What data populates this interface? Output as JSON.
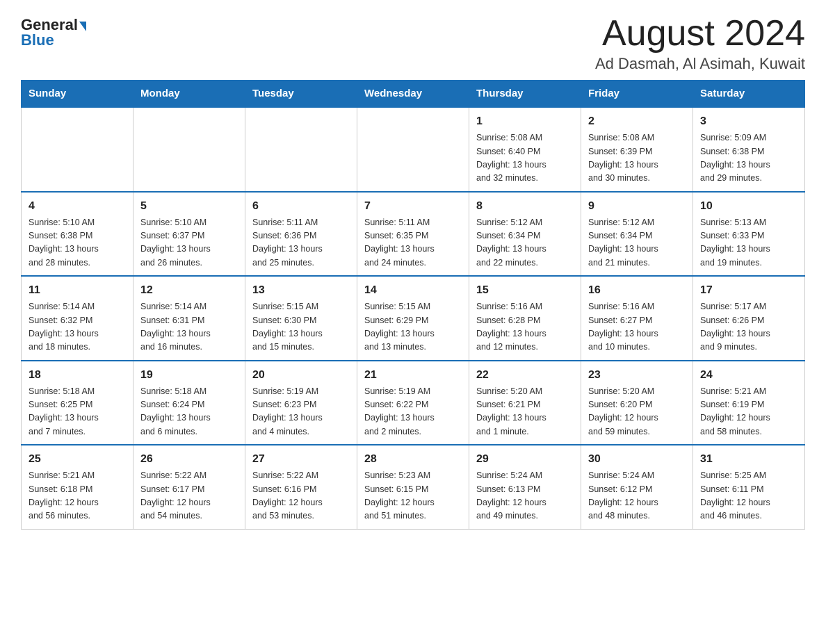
{
  "header": {
    "logo_general": "General",
    "logo_blue": "Blue",
    "month_title": "August 2024",
    "location": "Ad Dasmah, Al Asimah, Kuwait"
  },
  "weekdays": [
    "Sunday",
    "Monday",
    "Tuesday",
    "Wednesday",
    "Thursday",
    "Friday",
    "Saturday"
  ],
  "weeks": [
    {
      "days": [
        {
          "num": "",
          "info": ""
        },
        {
          "num": "",
          "info": ""
        },
        {
          "num": "",
          "info": ""
        },
        {
          "num": "",
          "info": ""
        },
        {
          "num": "1",
          "info": "Sunrise: 5:08 AM\nSunset: 6:40 PM\nDaylight: 13 hours\nand 32 minutes."
        },
        {
          "num": "2",
          "info": "Sunrise: 5:08 AM\nSunset: 6:39 PM\nDaylight: 13 hours\nand 30 minutes."
        },
        {
          "num": "3",
          "info": "Sunrise: 5:09 AM\nSunset: 6:38 PM\nDaylight: 13 hours\nand 29 minutes."
        }
      ]
    },
    {
      "days": [
        {
          "num": "4",
          "info": "Sunrise: 5:10 AM\nSunset: 6:38 PM\nDaylight: 13 hours\nand 28 minutes."
        },
        {
          "num": "5",
          "info": "Sunrise: 5:10 AM\nSunset: 6:37 PM\nDaylight: 13 hours\nand 26 minutes."
        },
        {
          "num": "6",
          "info": "Sunrise: 5:11 AM\nSunset: 6:36 PM\nDaylight: 13 hours\nand 25 minutes."
        },
        {
          "num": "7",
          "info": "Sunrise: 5:11 AM\nSunset: 6:35 PM\nDaylight: 13 hours\nand 24 minutes."
        },
        {
          "num": "8",
          "info": "Sunrise: 5:12 AM\nSunset: 6:34 PM\nDaylight: 13 hours\nand 22 minutes."
        },
        {
          "num": "9",
          "info": "Sunrise: 5:12 AM\nSunset: 6:34 PM\nDaylight: 13 hours\nand 21 minutes."
        },
        {
          "num": "10",
          "info": "Sunrise: 5:13 AM\nSunset: 6:33 PM\nDaylight: 13 hours\nand 19 minutes."
        }
      ]
    },
    {
      "days": [
        {
          "num": "11",
          "info": "Sunrise: 5:14 AM\nSunset: 6:32 PM\nDaylight: 13 hours\nand 18 minutes."
        },
        {
          "num": "12",
          "info": "Sunrise: 5:14 AM\nSunset: 6:31 PM\nDaylight: 13 hours\nand 16 minutes."
        },
        {
          "num": "13",
          "info": "Sunrise: 5:15 AM\nSunset: 6:30 PM\nDaylight: 13 hours\nand 15 minutes."
        },
        {
          "num": "14",
          "info": "Sunrise: 5:15 AM\nSunset: 6:29 PM\nDaylight: 13 hours\nand 13 minutes."
        },
        {
          "num": "15",
          "info": "Sunrise: 5:16 AM\nSunset: 6:28 PM\nDaylight: 13 hours\nand 12 minutes."
        },
        {
          "num": "16",
          "info": "Sunrise: 5:16 AM\nSunset: 6:27 PM\nDaylight: 13 hours\nand 10 minutes."
        },
        {
          "num": "17",
          "info": "Sunrise: 5:17 AM\nSunset: 6:26 PM\nDaylight: 13 hours\nand 9 minutes."
        }
      ]
    },
    {
      "days": [
        {
          "num": "18",
          "info": "Sunrise: 5:18 AM\nSunset: 6:25 PM\nDaylight: 13 hours\nand 7 minutes."
        },
        {
          "num": "19",
          "info": "Sunrise: 5:18 AM\nSunset: 6:24 PM\nDaylight: 13 hours\nand 6 minutes."
        },
        {
          "num": "20",
          "info": "Sunrise: 5:19 AM\nSunset: 6:23 PM\nDaylight: 13 hours\nand 4 minutes."
        },
        {
          "num": "21",
          "info": "Sunrise: 5:19 AM\nSunset: 6:22 PM\nDaylight: 13 hours\nand 2 minutes."
        },
        {
          "num": "22",
          "info": "Sunrise: 5:20 AM\nSunset: 6:21 PM\nDaylight: 13 hours\nand 1 minute."
        },
        {
          "num": "23",
          "info": "Sunrise: 5:20 AM\nSunset: 6:20 PM\nDaylight: 12 hours\nand 59 minutes."
        },
        {
          "num": "24",
          "info": "Sunrise: 5:21 AM\nSunset: 6:19 PM\nDaylight: 12 hours\nand 58 minutes."
        }
      ]
    },
    {
      "days": [
        {
          "num": "25",
          "info": "Sunrise: 5:21 AM\nSunset: 6:18 PM\nDaylight: 12 hours\nand 56 minutes."
        },
        {
          "num": "26",
          "info": "Sunrise: 5:22 AM\nSunset: 6:17 PM\nDaylight: 12 hours\nand 54 minutes."
        },
        {
          "num": "27",
          "info": "Sunrise: 5:22 AM\nSunset: 6:16 PM\nDaylight: 12 hours\nand 53 minutes."
        },
        {
          "num": "28",
          "info": "Sunrise: 5:23 AM\nSunset: 6:15 PM\nDaylight: 12 hours\nand 51 minutes."
        },
        {
          "num": "29",
          "info": "Sunrise: 5:24 AM\nSunset: 6:13 PM\nDaylight: 12 hours\nand 49 minutes."
        },
        {
          "num": "30",
          "info": "Sunrise: 5:24 AM\nSunset: 6:12 PM\nDaylight: 12 hours\nand 48 minutes."
        },
        {
          "num": "31",
          "info": "Sunrise: 5:25 AM\nSunset: 6:11 PM\nDaylight: 12 hours\nand 46 minutes."
        }
      ]
    }
  ]
}
